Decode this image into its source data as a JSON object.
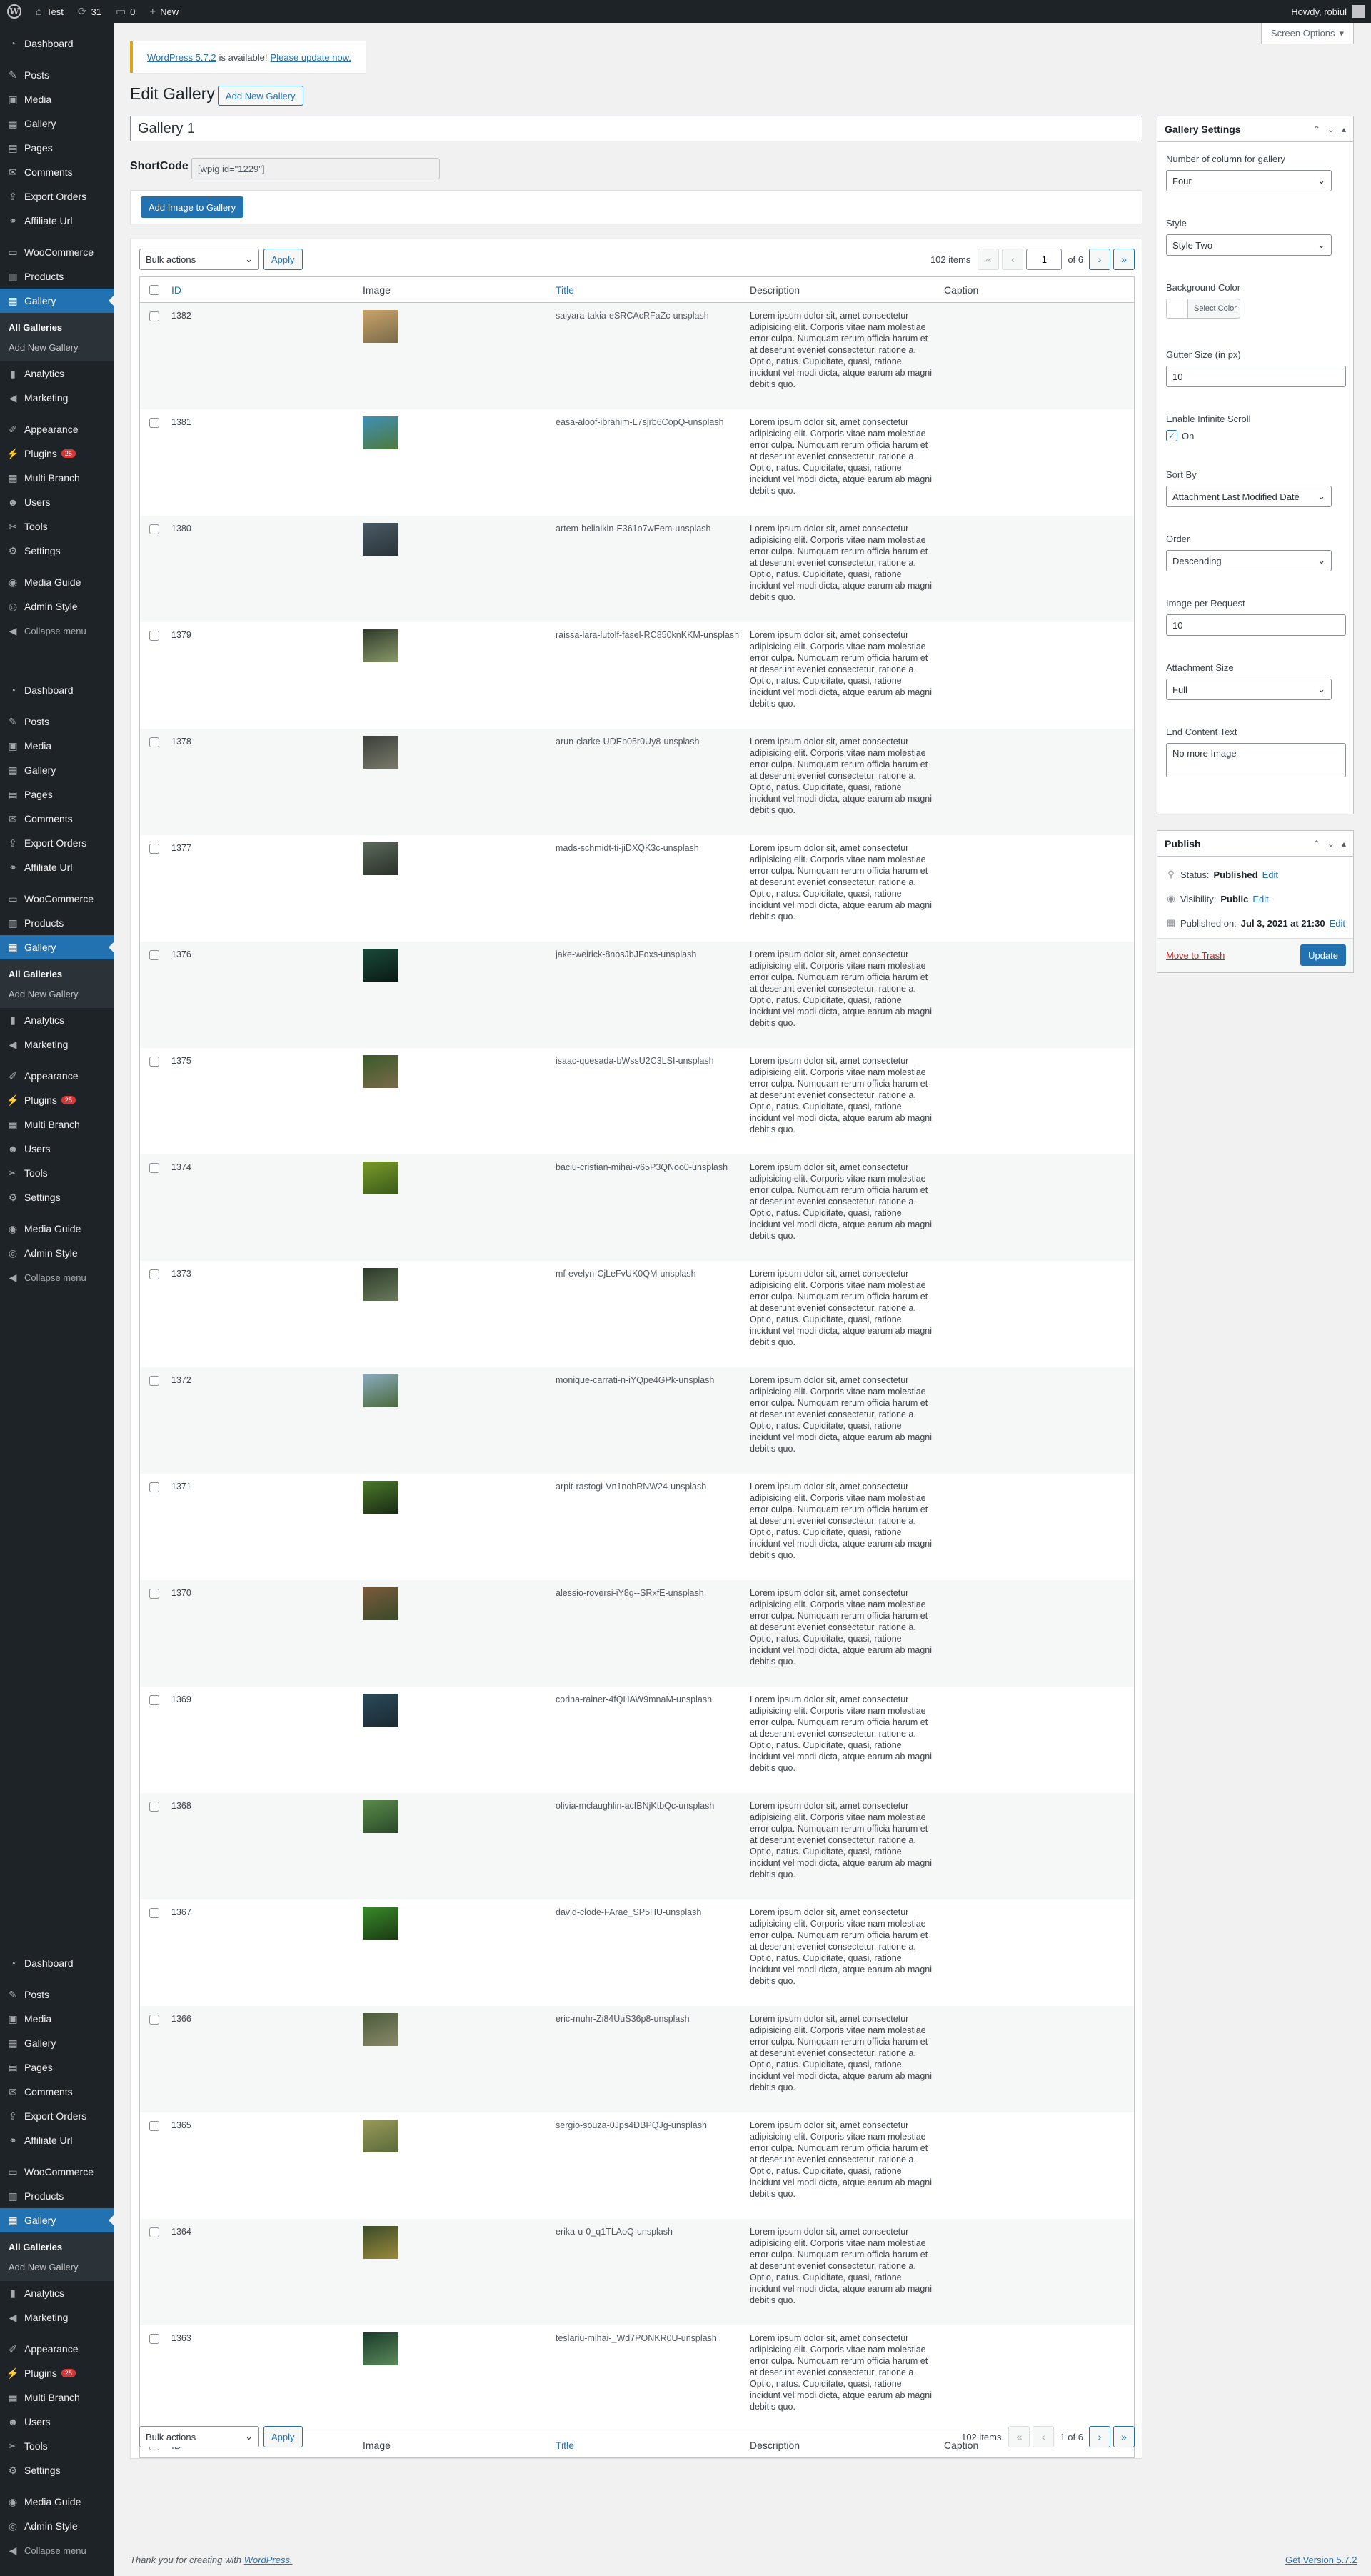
{
  "adminbar": {
    "site_name": "Test",
    "updates_count": "31",
    "comments_count": "0",
    "new_label": "New",
    "greeting": "Howdy, robiul"
  },
  "sidebar": {
    "items": [
      {
        "label": "Dashboard",
        "icon": "dashboard-icon",
        "glyph": "◔"
      },
      {
        "label": "Posts",
        "icon": "pin-icon",
        "glyph": "✎",
        "gap": true
      },
      {
        "label": "Media",
        "icon": "media-icon",
        "glyph": "▣"
      },
      {
        "label": "Gallery",
        "icon": "gallery-icon",
        "glyph": "▦"
      },
      {
        "label": "Pages",
        "icon": "pages-icon",
        "glyph": "▤"
      },
      {
        "label": "Comments",
        "icon": "comments-icon",
        "glyph": "✉"
      },
      {
        "label": "Export Orders",
        "icon": "export-icon",
        "glyph": "⇪"
      },
      {
        "label": "Affiliate Url",
        "icon": "link-icon",
        "glyph": "⚭"
      },
      {
        "label": "WooCommerce",
        "icon": "woocommerce-icon",
        "glyph": "▭",
        "gap": true
      },
      {
        "label": "Products",
        "icon": "products-icon",
        "glyph": "▥"
      },
      {
        "label": "Gallery",
        "icon": "gallery-icon",
        "glyph": "▦",
        "current": true
      },
      {
        "label": "Analytics",
        "icon": "analytics-icon",
        "glyph": "▮"
      },
      {
        "label": "Marketing",
        "icon": "megaphone-icon",
        "glyph": "◀"
      },
      {
        "label": "Appearance",
        "icon": "brush-icon",
        "glyph": "✐",
        "gap": true
      },
      {
        "label": "Plugins",
        "icon": "plugins-icon",
        "glyph": "⚡",
        "badge": "25"
      },
      {
        "label": "Multi Branch",
        "icon": "branch-icon",
        "glyph": "▦"
      },
      {
        "label": "Users",
        "icon": "users-icon",
        "glyph": "☻"
      },
      {
        "label": "Tools",
        "icon": "tools-icon",
        "glyph": "✂"
      },
      {
        "label": "Settings",
        "icon": "settings-icon",
        "glyph": "⚙"
      },
      {
        "label": "Media Guide",
        "icon": "guide-icon",
        "glyph": "◉",
        "gap": true
      },
      {
        "label": "Admin Style",
        "icon": "style-icon",
        "glyph": "◎"
      },
      {
        "label": "Collapse menu",
        "icon": "collapse-icon",
        "glyph": "◀",
        "collapse": true
      }
    ],
    "submenu": [
      "All Galleries",
      "Add New Gallery"
    ]
  },
  "screen_options": "Screen Options",
  "notice": {
    "link1": "WordPress 5.7.2",
    "middle": "is available!",
    "link2": "Please update now."
  },
  "page": {
    "title": "Edit Gallery",
    "add_new": "Add New Gallery",
    "gallery_title": "Gallery 1",
    "shortcode_label": "ShortCode",
    "shortcode_value": "[wpig id=\"1229\"]",
    "add_image_button": "Add Image to Gallery"
  },
  "table": {
    "bulk_actions": "Bulk actions",
    "apply": "Apply",
    "items_count": "102 items",
    "current_page": "1",
    "of_pages": "of 6",
    "footer_page": "1 of 6",
    "columns": {
      "id": "ID",
      "image": "Image",
      "title": "Title",
      "description": "Description",
      "caption": "Caption"
    },
    "description_text": "Lorem ipsum dolor sit, amet consectetur adipisicing elit. Corporis vitae nam molestiae error culpa. Numquam rerum officia harum et at deserunt eveniet consectetur, ratione a. Optio, natus. Cupiditate, quasi, ratione incidunt vel modi dicta, atque earum ab magni debitis quo.",
    "rows": [
      {
        "id": "1382",
        "title": "saiyara-takia-eSRCAcRFaZc-unsplash",
        "colors": [
          "#c9a36a",
          "#7a6a4a"
        ]
      },
      {
        "id": "1381",
        "title": "easa-aloof-ibrahim-L7sjrb6CopQ-unsplash",
        "colors": [
          "#3f8fb8",
          "#4f7a3a"
        ]
      },
      {
        "id": "1380",
        "title": "artem-beliaikin-E361o7wEem-unsplash",
        "colors": [
          "#4a5a66",
          "#2a3438"
        ]
      },
      {
        "id": "1379",
        "title": "raissa-lara-lutolf-fasel-RC850knKKM-unsplash",
        "colors": [
          "#2f3a2a",
          "#8a9a6a"
        ]
      },
      {
        "id": "1378",
        "title": "arun-clarke-UDEb05r0Uy8-unsplash",
        "colors": [
          "#3a3f3a",
          "#7a7a6a"
        ]
      },
      {
        "id": "1377",
        "title": "mads-schmidt-ti-jiDXQK3c-unsplash",
        "colors": [
          "#5a6a5a",
          "#2a302a"
        ]
      },
      {
        "id": "1376",
        "title": "jake-weirick-8nosJbJFoxs-unsplash",
        "colors": [
          "#1a4a3a",
          "#0a1a14"
        ]
      },
      {
        "id": "1375",
        "title": "isaac-quesada-bWssU2C3LSI-unsplash",
        "colors": [
          "#3a5a2a",
          "#7a6a4a"
        ]
      },
      {
        "id": "1374",
        "title": "baciu-cristian-mihai-v65P3QNoo0-unsplash",
        "colors": [
          "#7a9a2a",
          "#3a5a1a"
        ]
      },
      {
        "id": "1373",
        "title": "mf-evelyn-CjLeFvUK0QM-unsplash",
        "colors": [
          "#2a3a2a",
          "#6a7a5a"
        ]
      },
      {
        "id": "1372",
        "title": "monique-carrati-n-iYQpe4GPk-unsplash",
        "colors": [
          "#8aaac0",
          "#4a6a3a"
        ]
      },
      {
        "id": "1371",
        "title": "arpit-rastogi-Vn1nohRNW24-unsplash",
        "colors": [
          "#4a7a2a",
          "#1a2a14"
        ]
      },
      {
        "id": "1370",
        "title": "alessio-roversi-iY8g--SRxfE-unsplash",
        "colors": [
          "#7a5a3a",
          "#3a4a2a"
        ]
      },
      {
        "id": "1369",
        "title": "corina-rainer-4fQHAW9mnaM-unsplash",
        "colors": [
          "#2a4a5a",
          "#1a2a30"
        ]
      },
      {
        "id": "1368",
        "title": "olivia-mclaughlin-acfBNjKtbQc-unsplash",
        "colors": [
          "#5a8a4a",
          "#2a4a2a"
        ]
      },
      {
        "id": "1367",
        "title": "david-clode-FArae_SP5HU-unsplash",
        "colors": [
          "#3a8a2a",
          "#1a3a14"
        ]
      },
      {
        "id": "1366",
        "title": "eric-muhr-Zi84UuS36p8-unsplash",
        "colors": [
          "#4a5a3a",
          "#8a8a6a"
        ]
      },
      {
        "id": "1365",
        "title": "sergio-souza-0Jps4DBPQJg-unsplash",
        "colors": [
          "#9a9a5a",
          "#5a6a3a"
        ]
      },
      {
        "id": "1364",
        "title": "erika-u-0_q1TLAoQ-unsplash",
        "colors": [
          "#3a4a2a",
          "#9a8a3a"
        ]
      },
      {
        "id": "1363",
        "title": "teslariu-mihai-_Wd7PONKR0U-unsplash",
        "colors": [
          "#1a3a2a",
          "#5a8a5a"
        ]
      }
    ]
  },
  "gallery_settings": {
    "title": "Gallery Settings",
    "columns_label": "Number of column for gallery",
    "columns_value": "Four",
    "style_label": "Style",
    "style_value": "Style Two",
    "bg_color_label": "Background Color",
    "select_color": "Select Color",
    "gutter_label": "Gutter Size (in px)",
    "gutter_value": "10",
    "infinite_label": "Enable Infinite Scroll",
    "infinite_value": "On",
    "sort_label": "Sort By",
    "sort_value": "Attachment Last Modified Date",
    "order_label": "Order",
    "order_value": "Descending",
    "per_request_label": "Image per Request",
    "per_request_value": "10",
    "attachment_label": "Attachment Size",
    "attachment_value": "Full",
    "end_text_label": "End Content Text",
    "end_text_value": "No more Image"
  },
  "publish": {
    "title": "Publish",
    "status_label": "Status:",
    "status_value": "Published",
    "visibility_label": "Visibility:",
    "visibility_value": "Public",
    "published_label": "Published on:",
    "published_value": "Jul 3, 2021 at 21:30",
    "edit": "Edit",
    "trash": "Move to Trash",
    "update": "Update"
  },
  "footer": {
    "thanks": "Thank you for creating with",
    "wp_link": "WordPress.",
    "version": "Get Version 5.7.2"
  }
}
